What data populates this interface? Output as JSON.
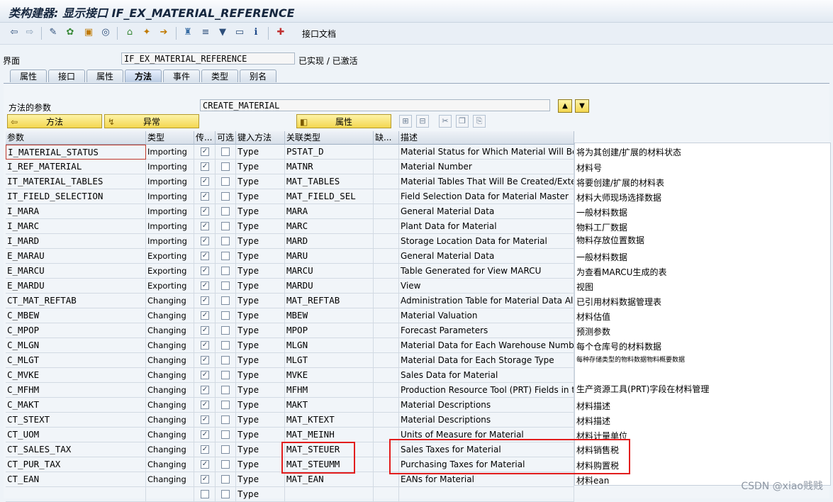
{
  "title": "类构建器: 显示接口 IF_EX_MATERIAL_REFERENCE",
  "toolbar": {
    "interface_doc": "接口文档"
  },
  "header": {
    "interface_label": "界面",
    "interface_value": "IF_EX_MATERIAL_REFERENCE",
    "status": "已实现 / 已激活"
  },
  "tabs": [
    "属性",
    "接口",
    "属性",
    "方法",
    "事件",
    "类型",
    "别名"
  ],
  "method_params": {
    "label": "方法的参数",
    "method_name": "CREATE_MATERIAL",
    "methods_button": "方法",
    "exceptions_button": "异常",
    "attributes_button": "属性"
  },
  "columns": [
    "参数",
    "类型",
    "传...",
    "可选",
    "键入方法",
    "关联类型",
    "缺...",
    "描述"
  ],
  "rows": [
    {
      "param": "I_MATERIAL_STATUS",
      "type": "Importing",
      "typing": "Type",
      "ref": "PSTAT_D",
      "desc": "Material Status for Which Material Will Be Cr..."
    },
    {
      "param": "I_REF_MATERIAL",
      "type": "Importing",
      "typing": "Type",
      "ref": "MATNR",
      "desc": "Material Number"
    },
    {
      "param": "IT_MATERIAL_TABLES",
      "type": "Importing",
      "typing": "Type",
      "ref": "MAT_TABLES",
      "desc": "Material Tables That Will Be Created/Exten..."
    },
    {
      "param": "IT_FIELD_SELECTION",
      "type": "Importing",
      "typing": "Type",
      "ref": "MAT_FIELD_SEL",
      "desc": "Field Selection Data for Material Master"
    },
    {
      "param": "I_MARA",
      "type": "Importing",
      "typing": "Type",
      "ref": "MARA",
      "desc": "General Material Data"
    },
    {
      "param": "I_MARC",
      "type": "Importing",
      "typing": "Type",
      "ref": "MARC",
      "desc": "Plant Data for Material"
    },
    {
      "param": "I_MARD",
      "type": "Importing",
      "typing": "Type",
      "ref": "MARD",
      "desc": "Storage Location Data for Material"
    },
    {
      "param": "E_MARAU",
      "type": "Exporting",
      "typing": "Type",
      "ref": "MARU",
      "desc": "General Material Data"
    },
    {
      "param": "E_MARCU",
      "type": "Exporting",
      "typing": "Type",
      "ref": "MARCU",
      "desc": "Table Generated for View MARCU"
    },
    {
      "param": "E_MARDU",
      "type": "Exporting",
      "typing": "Type",
      "ref": "MARDU",
      "desc": "View"
    },
    {
      "param": "CT_MAT_REFTAB",
      "type": "Changing",
      "typing": "Type",
      "ref": "MAT_REFTAB",
      "desc": "Administration Table for Material Data Alrea..."
    },
    {
      "param": "C_MBEW",
      "type": "Changing",
      "typing": "Type",
      "ref": "MBEW",
      "desc": "Material Valuation"
    },
    {
      "param": "C_MPOP",
      "type": "Changing",
      "typing": "Type",
      "ref": "MPOP",
      "desc": "Forecast Parameters"
    },
    {
      "param": "C_MLGN",
      "type": "Changing",
      "typing": "Type",
      "ref": "MLGN",
      "desc": "Material Data for Each Warehouse Number"
    },
    {
      "param": "C_MLGT",
      "type": "Changing",
      "typing": "Type",
      "ref": "MLGT",
      "desc": "Material Data for Each Storage Type"
    },
    {
      "param": "C_MVKE",
      "type": "Changing",
      "typing": "Type",
      "ref": "MVKE",
      "desc": "Sales Data for Material"
    },
    {
      "param": "C_MFHM",
      "type": "Changing",
      "typing": "Type",
      "ref": "MFHM",
      "desc": "Production Resource Tool (PRT) Fields in t..."
    },
    {
      "param": "C_MAKT",
      "type": "Changing",
      "typing": "Type",
      "ref": "MAKT",
      "desc": "Material Descriptions"
    },
    {
      "param": "CT_STEXT",
      "type": "Changing",
      "typing": "Type",
      "ref": "MAT_KTEXT",
      "desc": "Material Descriptions"
    },
    {
      "param": "CT_UOM",
      "type": "Changing",
      "typing": "Type",
      "ref": "MAT_MEINH",
      "desc": "Units of Measure for Material"
    },
    {
      "param": "CT_SALES_TAX",
      "type": "Changing",
      "typing": "Type",
      "ref": "MAT_STEUER",
      "desc": "Sales Taxes for Material"
    },
    {
      "param": "CT_PUR_TAX",
      "type": "Changing",
      "typing": "Type",
      "ref": "MAT_STEUMM",
      "desc": "Purchasing Taxes for Material"
    },
    {
      "param": "CT_EAN",
      "type": "Changing",
      "typing": "Type",
      "ref": "MAT_EAN",
      "desc": "EANs for Material"
    },
    {
      "param": "",
      "type": "",
      "typing": "Type",
      "ref": "",
      "desc": ""
    }
  ],
  "translations": [
    "将为其创建/扩展的材料状态",
    "材料号",
    "将要创建/扩展的材料表",
    "材料大师现场选择数据",
    "一般材料数据",
    "物料工厂数据",
    "物料存放位置数据",
    "一般材料数据",
    "为查看MARCU生成的表",
    "视图",
    "已引用材料数据管理表",
    "材料估值",
    "预测参数",
    "每个仓库号的材料数据",
    "每种存储类型的物料数据物料概要数据",
    "生产资源工具(PRT)字段在材料管理",
    "材料描述",
    "材料描述",
    "材料计量单位",
    "材料销售税",
    "材料购置税",
    "材料ean"
  ],
  "watermark": "CSDN @xiao贱贱",
  "colors": {
    "highlight": "#e21d1d",
    "button_yellow": "#f4d750"
  }
}
